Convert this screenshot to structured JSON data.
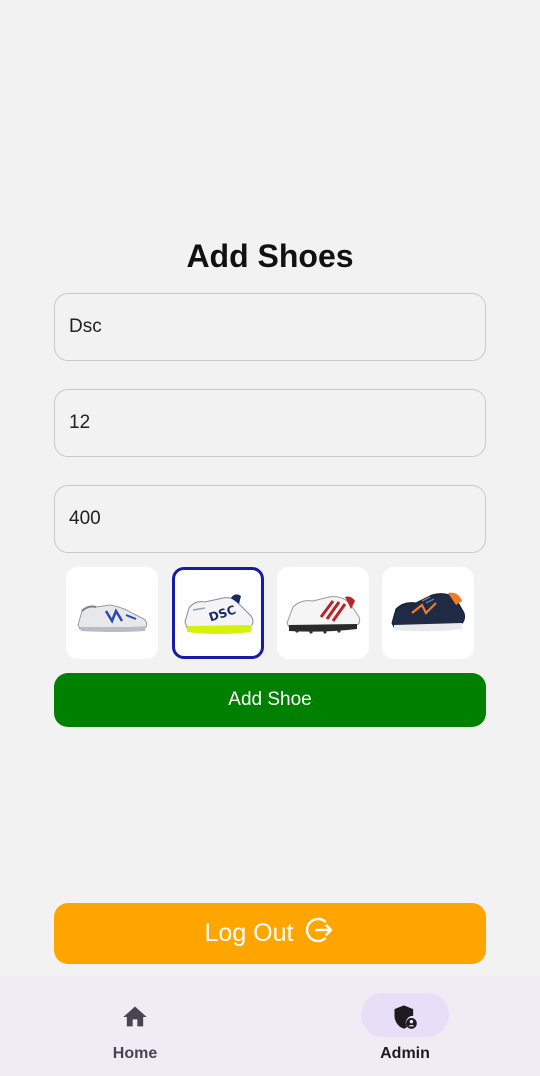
{
  "page": {
    "title": "Add Shoes"
  },
  "form": {
    "name_value": "Dsc",
    "size_value": "12",
    "price_value": "400"
  },
  "shoe_options": [
    {
      "name": "new-balance-shoe",
      "selected": false
    },
    {
      "name": "dsc-shoe",
      "selected": true
    },
    {
      "name": "adidas-red-shoe",
      "selected": false
    },
    {
      "name": "navy-running-shoe",
      "selected": false
    }
  ],
  "buttons": {
    "add_label": "Add Shoe",
    "logout_label": "Log Out"
  },
  "bottom_nav": {
    "home_label": "Home",
    "admin_label": "Admin",
    "active": "Admin"
  },
  "colors": {
    "add_button": "#008000",
    "logout_button": "#ffa500",
    "selected_border": "#1a1aa8",
    "nav_active_pill": "#e8def8"
  }
}
